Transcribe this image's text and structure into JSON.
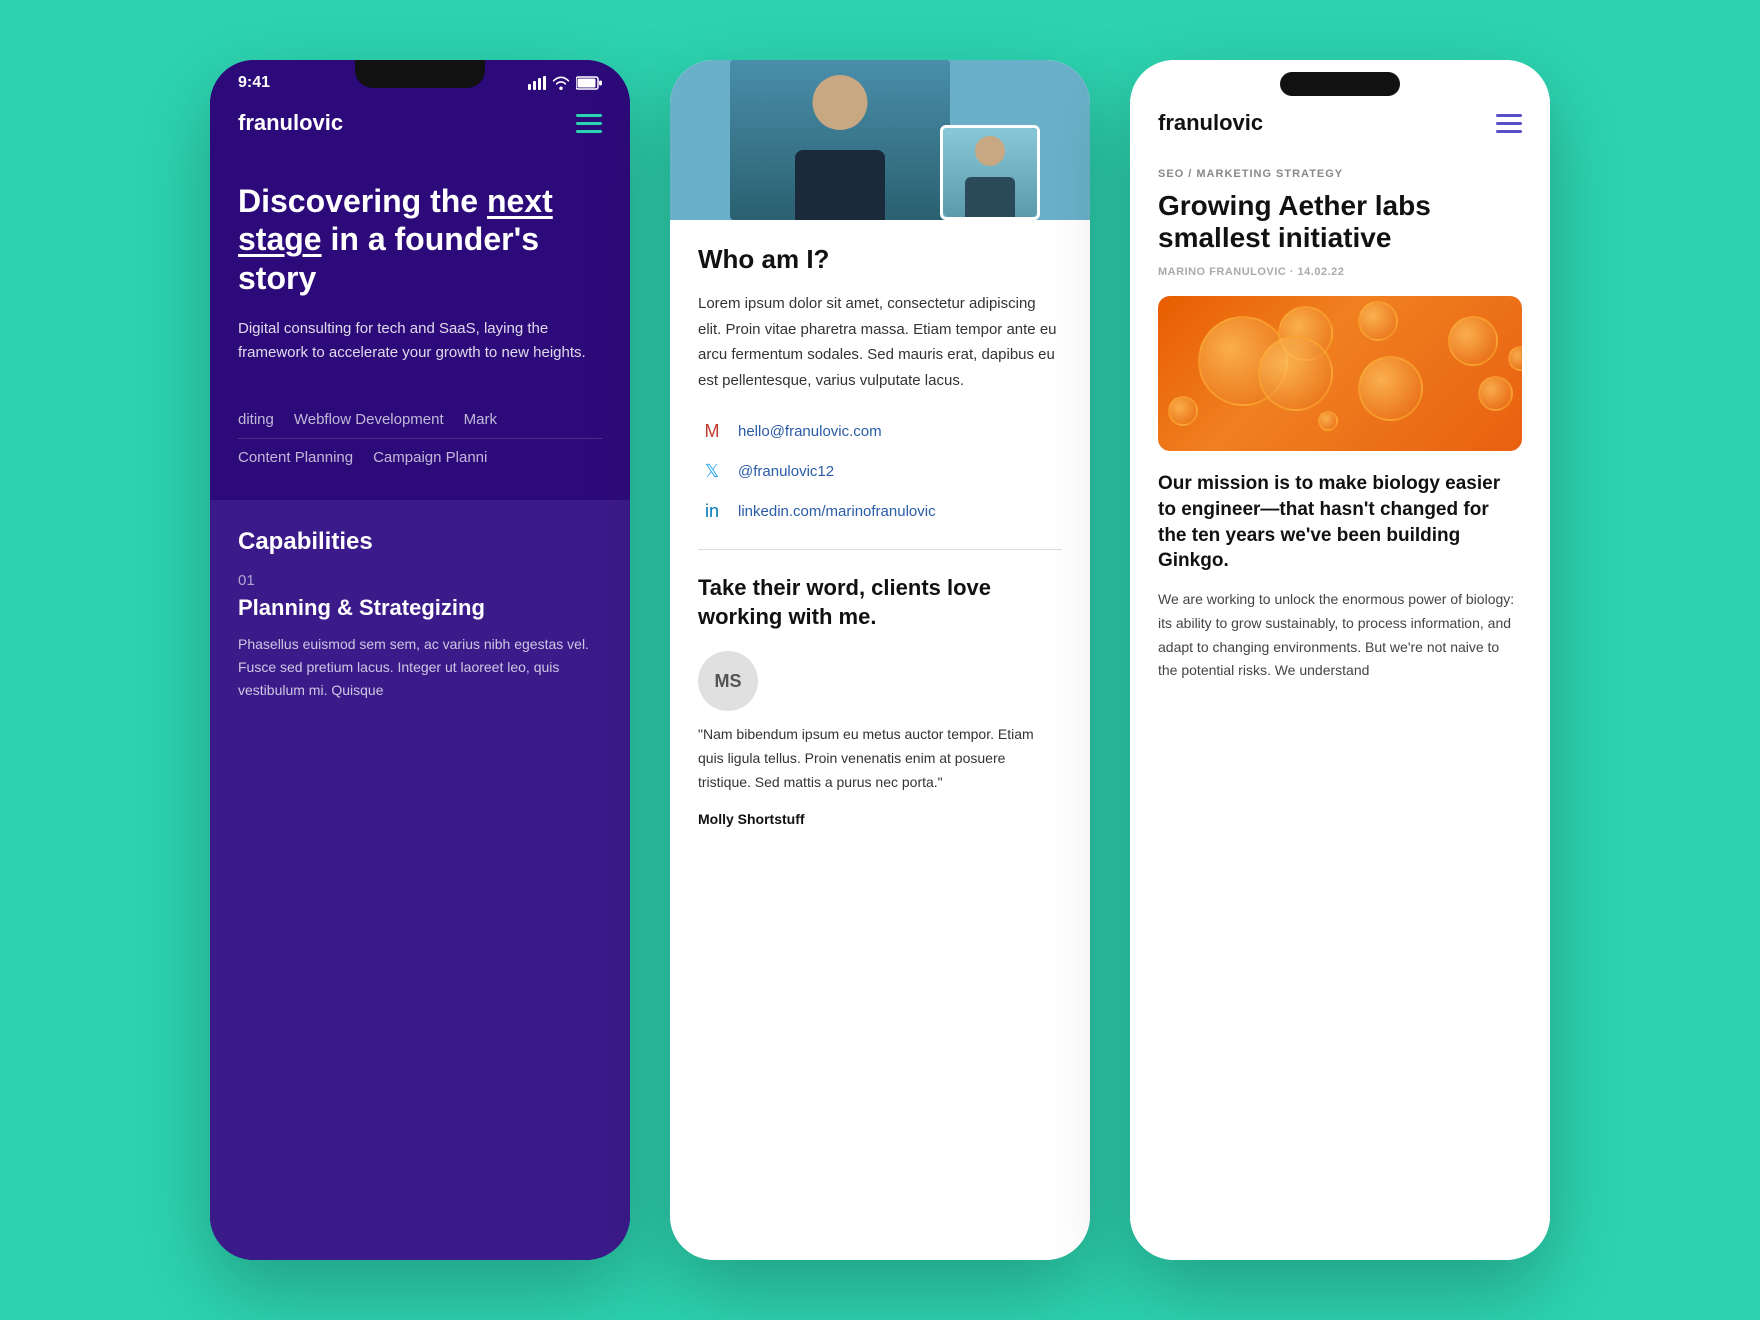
{
  "background_color": "#2dd4b0",
  "phone1": {
    "status_time": "9:41",
    "brand": "franulovic",
    "hero_title_part1": "Discovering the ",
    "hero_title_link": "next stage",
    "hero_title_part2": " in a founder's story",
    "hero_subtitle": "Digital consulting for tech and SaaS, laying the framework to accelerate your growth to new heights.",
    "services_row1": [
      "diting",
      "Webflow Development",
      "Mark"
    ],
    "services_row2": [
      "Content Planning",
      "Campaign Planni"
    ],
    "capabilities_title": "Capabilities",
    "cap_number": "01",
    "cap_item_title": "Planning & Strategizing",
    "cap_item_body": "Phasellus euismod sem sem, ac varius nibh egestas vel. Fusce sed pretium lacus. Integer ut laoreet leo, quis vestibulum mi. Quisque"
  },
  "phone2": {
    "who_am_i_title": "Who am I?",
    "who_am_i_body": "Lorem ipsum dolor sit amet, consectetur adipiscing elit. Proin vitae pharetra massa. Etiam tempor ante eu arcu fermentum sodales. Sed mauris erat, dapibus eu est pellentesque, varius vulputate lacus.",
    "email": "hello@franulovic.com",
    "twitter": "@franulovic12",
    "linkedin": "linkedin.com/marinofranulovic",
    "testimonial_title": "Take their word, clients love working with me.",
    "avatar_initials": "MS",
    "testimonial_text": "\"Nam bibendum ipsum eu metus auctor tempor. Etiam quis ligula tellus. Proin venenatis enim at posuere tristique. Sed mattis a purus nec porta.\"",
    "testimonial_author": "Molly Shortstuff"
  },
  "phone3": {
    "brand": "franulovic",
    "article_category": "SEO / MARKETING STRATEGY",
    "article_title": "Growing Aether labs smallest initiative",
    "article_meta": "MARINO FRANULOVIC · 14.02.22",
    "article_body_title": "Our mission is to make biology easier to engineer—that hasn't changed for the ten years we've been building Ginkgo.",
    "article_body_text": "We are working to unlock the enormous power of biology: its ability to grow sustainably, to process information, and adapt to changing environments. But we're not naive to the potential risks. We understand"
  }
}
